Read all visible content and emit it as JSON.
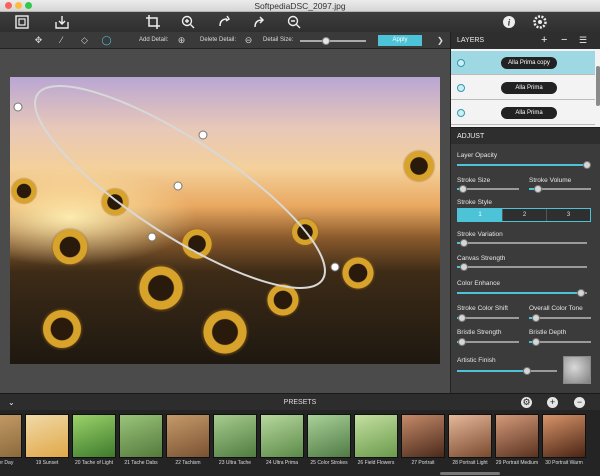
{
  "window": {
    "title": "SoftpediaDSC_2097.jpg"
  },
  "toolbar": {
    "icons": [
      "open-image-icon",
      "save-icon",
      "crop-icon",
      "zoom-in-icon",
      "rotate-left-icon",
      "rotate-right-icon",
      "zoom-out-icon",
      "info-icon",
      "settings-icon"
    ]
  },
  "options": {
    "add_detail_label": "Add Detail:",
    "delete_detail_label": "Delete Detail:",
    "detail_size_label": "Detail Size:",
    "detail_size_value": 0.4,
    "apply_label": "Apply"
  },
  "layers": {
    "header": "LAYERS",
    "items": [
      {
        "name": "Alla Prima copy",
        "selected": true
      },
      {
        "name": "Alla Prima",
        "selected": false
      },
      {
        "name": "Alla Prima",
        "selected": false
      }
    ]
  },
  "adjust": {
    "header": "ADJUST",
    "sliders": {
      "layer_opacity": {
        "label": "Layer Opacity",
        "value": 1.0
      },
      "stroke_size": {
        "label": "Stroke Size",
        "value": 0.1
      },
      "stroke_volume": {
        "label": "Stroke Volume",
        "value": 0.15
      },
      "stroke_variation": {
        "label": "Stroke Variation",
        "value": 0.05
      },
      "canvas_strength": {
        "label": "Canvas Strength",
        "value": 0.05
      },
      "color_enhance": {
        "label": "Color Enhance",
        "value": 0.95
      },
      "stroke_color_shift": {
        "label": "Stroke Color Shift",
        "value": 0.08
      },
      "overall_color_tone": {
        "label": "Overall Color Tone",
        "value": 0.12
      },
      "bristle_strength": {
        "label": "Bristle Strength",
        "value": 0.08
      },
      "bristle_depth": {
        "label": "Bristle Depth",
        "value": 0.12
      },
      "artistic_finish": {
        "label": "Artistic Finish",
        "value": 0.7
      }
    },
    "stroke_style": {
      "label": "Stroke Style",
      "options": [
        "1",
        "2",
        "3"
      ],
      "selected": "1"
    }
  },
  "presets": {
    "title": "PRESETS",
    "items": [
      {
        "label": "…mber Day",
        "colors": [
          "#c9a06b",
          "#8c6a3c"
        ]
      },
      {
        "label": "19 Sunset",
        "colors": [
          "#f0d9a8",
          "#e0a848"
        ]
      },
      {
        "label": "20 Tache of Light",
        "colors": [
          "#9bd36a",
          "#3e7a2c"
        ]
      },
      {
        "label": "21 Tache Dabs",
        "colors": [
          "#9ac47a",
          "#547a3c"
        ]
      },
      {
        "label": "22 Tachism",
        "colors": [
          "#c59a6a",
          "#7a5232"
        ]
      },
      {
        "label": "23 Ultra Tache",
        "colors": [
          "#a8cc90",
          "#4f7c3f"
        ]
      },
      {
        "label": "24 Ultra Prima",
        "colors": [
          "#b7d89d",
          "#5b8a48"
        ]
      },
      {
        "label": "25 Color Strokes",
        "colors": [
          "#a9d19a",
          "#507a44"
        ]
      },
      {
        "label": "26 Field Flowers",
        "colors": [
          "#c4e0a0",
          "#6a9a4c"
        ]
      },
      {
        "label": "27 Portrait",
        "colors": [
          "#c58a6a",
          "#4a2a1a"
        ]
      },
      {
        "label": "28 Portrait Light",
        "colors": [
          "#e6b89a",
          "#7a4a2e"
        ]
      },
      {
        "label": "29 Portrait Medium",
        "colors": [
          "#d49a7a",
          "#5a3220"
        ]
      },
      {
        "label": "30 Portrait Warm",
        "colors": [
          "#d8946a",
          "#4a2414"
        ]
      }
    ]
  },
  "colors": {
    "accent": "#4cc3d6"
  }
}
